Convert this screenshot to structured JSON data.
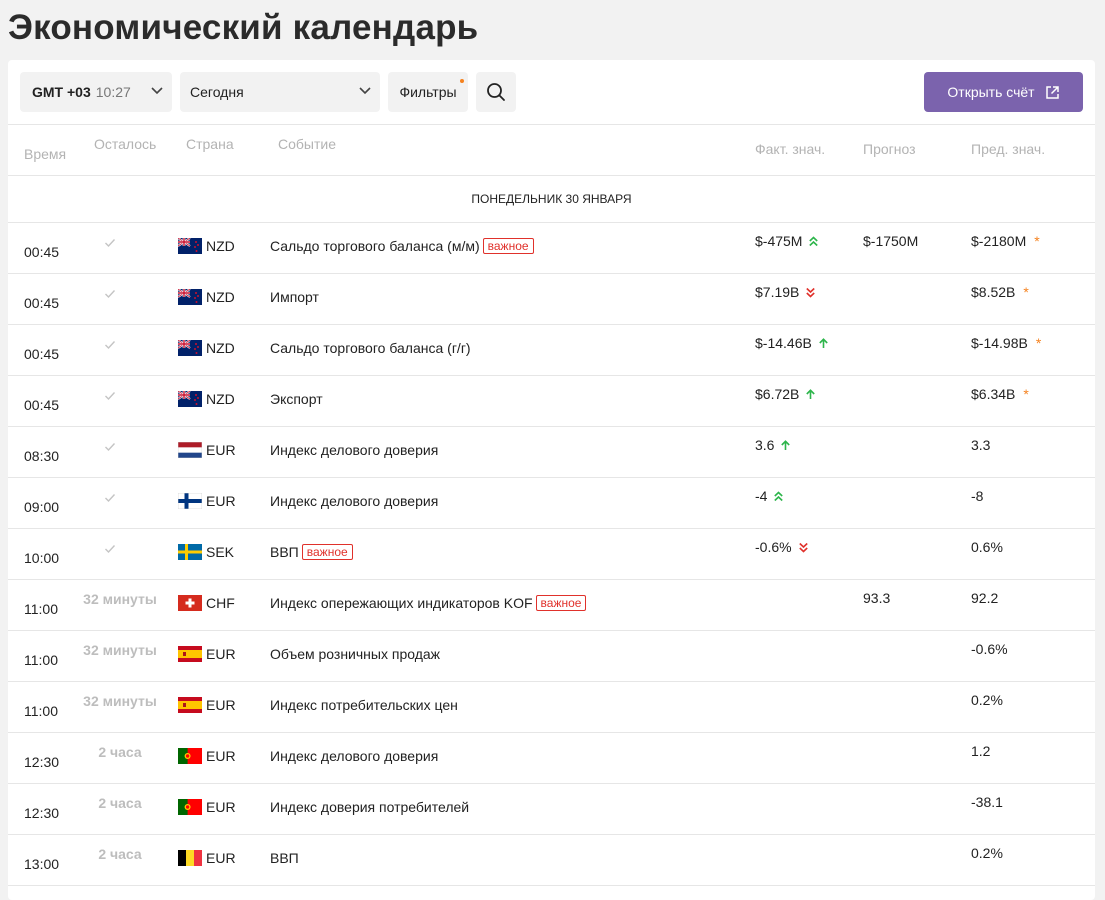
{
  "page": {
    "title": "Экономический календарь"
  },
  "toolbar": {
    "tz_label": "GMT +03",
    "tz_time": "10:27",
    "date_value": "Сегодня",
    "filters_label": "Фильтры",
    "open_account_label": "Открыть счёт"
  },
  "table": {
    "headers": {
      "time": "Время",
      "left": "Осталось",
      "country": "Страна",
      "event": "Событие",
      "actual": "Факт. знач.",
      "forecast": "Прогноз",
      "previous": "Пред. знач."
    },
    "day_label": "ПОНЕДЕЛЬНИК 30 ЯНВАРЯ",
    "rows": [
      {
        "time": "00:45",
        "left": "",
        "done": true,
        "flag": "nz",
        "currency": "NZD",
        "event": "Сальдо торгового баланса (м/м)",
        "important": "важное",
        "actual": "$-475M",
        "trend": "double-up",
        "forecast": "$-1750M",
        "previous": "$-2180M",
        "revised": true
      },
      {
        "time": "00:45",
        "left": "",
        "done": true,
        "flag": "nz",
        "currency": "NZD",
        "event": "Импорт",
        "important": "",
        "actual": "$7.19B",
        "trend": "double-down",
        "forecast": "",
        "previous": "$8.52B",
        "revised": true
      },
      {
        "time": "00:45",
        "left": "",
        "done": true,
        "flag": "nz",
        "currency": "NZD",
        "event": "Сальдо торгового баланса (г/г)",
        "important": "",
        "actual": "$-14.46B",
        "trend": "up",
        "forecast": "",
        "previous": "$-14.98B",
        "revised": true
      },
      {
        "time": "00:45",
        "left": "",
        "done": true,
        "flag": "nz",
        "currency": "NZD",
        "event": "Экспорт",
        "important": "",
        "actual": "$6.72B",
        "trend": "up",
        "forecast": "",
        "previous": "$6.34B",
        "revised": true
      },
      {
        "time": "08:30",
        "left": "",
        "done": true,
        "flag": "nl",
        "currency": "EUR",
        "event": "Индекс делового доверия",
        "important": "",
        "actual": "3.6",
        "trend": "up",
        "forecast": "",
        "previous": "3.3",
        "revised": false
      },
      {
        "time": "09:00",
        "left": "",
        "done": true,
        "flag": "fi",
        "currency": "EUR",
        "event": "Индекс делового доверия",
        "important": "",
        "actual": "-4",
        "trend": "double-up",
        "forecast": "",
        "previous": "-8",
        "revised": false
      },
      {
        "time": "10:00",
        "left": "",
        "done": true,
        "flag": "se",
        "currency": "SEK",
        "event": "ВВП",
        "important": "важное",
        "actual": "-0.6%",
        "trend": "double-down",
        "forecast": "",
        "previous": "0.6%",
        "revised": false
      },
      {
        "time": "11:00",
        "left": "32 минуты",
        "done": false,
        "flag": "ch",
        "currency": "CHF",
        "event": "Индекс опережающих индикаторов KOF",
        "important": "важное",
        "actual": "",
        "trend": "",
        "forecast": "93.3",
        "previous": "92.2",
        "revised": false
      },
      {
        "time": "11:00",
        "left": "32 минуты",
        "done": false,
        "flag": "es",
        "currency": "EUR",
        "event": "Объем розничных продаж",
        "important": "",
        "actual": "",
        "trend": "",
        "forecast": "",
        "previous": "-0.6%",
        "revised": false
      },
      {
        "time": "11:00",
        "left": "32 минуты",
        "done": false,
        "flag": "es",
        "currency": "EUR",
        "event": "Индекс потребительских цен",
        "important": "",
        "actual": "",
        "trend": "",
        "forecast": "",
        "previous": "0.2%",
        "revised": false
      },
      {
        "time": "12:30",
        "left": "2 часа",
        "done": false,
        "flag": "pt",
        "currency": "EUR",
        "event": "Индекс делового доверия",
        "important": "",
        "actual": "",
        "trend": "",
        "forecast": "",
        "previous": "1.2",
        "revised": false
      },
      {
        "time": "12:30",
        "left": "2 часа",
        "done": false,
        "flag": "pt",
        "currency": "EUR",
        "event": "Индекс доверия потребителей",
        "important": "",
        "actual": "",
        "trend": "",
        "forecast": "",
        "previous": "-38.1",
        "revised": false
      },
      {
        "time": "13:00",
        "left": "2 часа",
        "done": false,
        "flag": "be",
        "currency": "EUR",
        "event": "ВВП",
        "important": "",
        "actual": "",
        "trend": "",
        "forecast": "",
        "previous": "0.2%",
        "revised": false
      }
    ]
  },
  "colors": {
    "accent": "#7b63ad",
    "up": "#2db54b",
    "down": "#e0312b",
    "star": "#f5821f"
  }
}
